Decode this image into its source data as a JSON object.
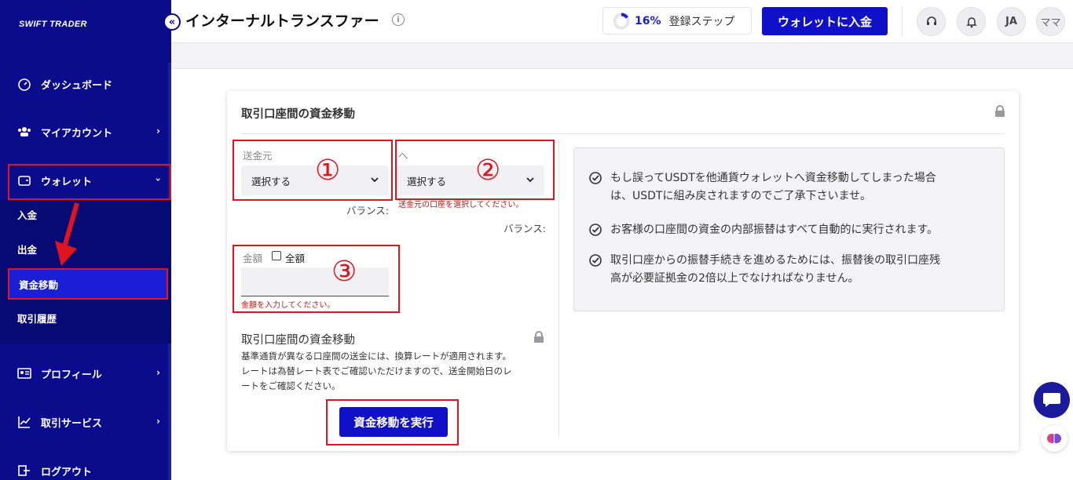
{
  "brand": {
    "logo_text": "SWIFT TRADER"
  },
  "sidebar": {
    "items": [
      {
        "label": "ダッシュボード",
        "icon": "dashboard-icon"
      },
      {
        "label": "マイアカウント",
        "icon": "users-icon"
      },
      {
        "label": "ウォレット",
        "icon": "wallet-icon"
      },
      {
        "label": "プロフィール",
        "icon": "id-card-icon"
      },
      {
        "label": "取引サービス",
        "icon": "chart-line-icon"
      },
      {
        "label": "ログアウト",
        "icon": "logout-icon"
      }
    ],
    "wallet_sub": [
      "入金",
      "出金",
      "資金移動",
      "取引履歴"
    ]
  },
  "header": {
    "title": "インターナルトランスファー",
    "progress_pct": "16%",
    "progress_fraction": 0.16,
    "reg_step_label": "登録ステップ",
    "deposit_button": "ウォレットに入金",
    "avatar_initials": "JA",
    "avatar_name": "ママ"
  },
  "card": {
    "title": "取引口座間の資金移動",
    "from_label": "送金元",
    "from_placeholder": "選択する",
    "to_label": "へ",
    "to_placeholder": "選択する",
    "balance_label": "バランス:",
    "to_error": "送金元の口座を選択してください。",
    "amount_label": "金額",
    "full_amount_label": "全額",
    "amount_error": "金額を入力してください。",
    "section2_title": "取引口座間の資金移動",
    "section2_lines": [
      "基準通貨が異なる口座間の送金には、換算レートが適用されます。",
      "レートは為替レート表でご確認いただけますので、送金開始日のレ",
      "ートをご確認ください。"
    ],
    "execute_button": "資金移動を実行",
    "notices": [
      [
        "もし誤ってUSDTを他通貨ウォレットへ資金移動してしまった場合",
        "は、USDTに組み戻されますのでご了承下さいませ。"
      ],
      [
        "お客様の口座間の資金の内部振替はすべて自動的に実行されます。"
      ],
      [
        "取引口座からの振替手続きを進めるためには、振替後の取引口座残",
        "高が必要証拠金の2倍以上でなければなりません。"
      ]
    ]
  },
  "annotations": {
    "mark1": "①",
    "mark2": "②",
    "mark3": "③"
  },
  "colors": {
    "sidebar": "#0a0c8c",
    "accent": "#1010c8",
    "annotation_red": "#e0141e"
  }
}
